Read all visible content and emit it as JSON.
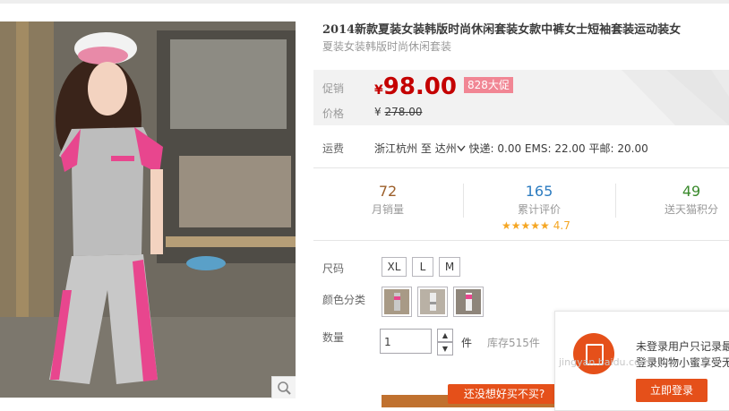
{
  "product": {
    "title": "2014新款夏装女装韩版时尚休闲套装女款中裤女士短袖套装运动装女",
    "subtitle": "夏装女装韩版时尚休闲套装"
  },
  "price": {
    "promo_label": "促销",
    "currency": "¥",
    "promo_value": "98.00",
    "promo_badge": "828大促",
    "orig_label": "价格",
    "orig_value": "278.00"
  },
  "shipping": {
    "label": "运费",
    "from": "浙江杭州",
    "to_word": "至",
    "to": "达州",
    "fees": "快递: 0.00 EMS: 22.00 平邮: 20.00"
  },
  "stats": [
    {
      "value": "72",
      "label": "月销量",
      "color": "#9c5f2a"
    },
    {
      "value": "165",
      "label": "累计评价",
      "color": "#2d7cc0"
    },
    {
      "value": "49",
      "label": "送天猫积分",
      "color": "#3a8a2c"
    }
  ],
  "rating": {
    "stars": "★★★★★",
    "score": "4.7",
    "value": 4.7
  },
  "sku": {
    "size_label": "尺码",
    "sizes": [
      "XL",
      "L",
      "M"
    ],
    "color_label": "颜色分类",
    "colors": [
      "pink-gray",
      "white-gray",
      "pink-white"
    ]
  },
  "quantity": {
    "label": "数量",
    "value": "1",
    "unit": "件",
    "stock": "库存515件"
  },
  "buttons": {
    "remind": "还没想好买不买?"
  },
  "login_popup": {
    "line1": "未登录用户只记录最",
    "line2": "登录购物小蜜享受无",
    "button": "立即登录"
  },
  "watermark": "jingyan.baidu.com",
  "colors": {
    "accent": "#c40000",
    "orange": "#e5501a",
    "badge": "#f18694"
  }
}
